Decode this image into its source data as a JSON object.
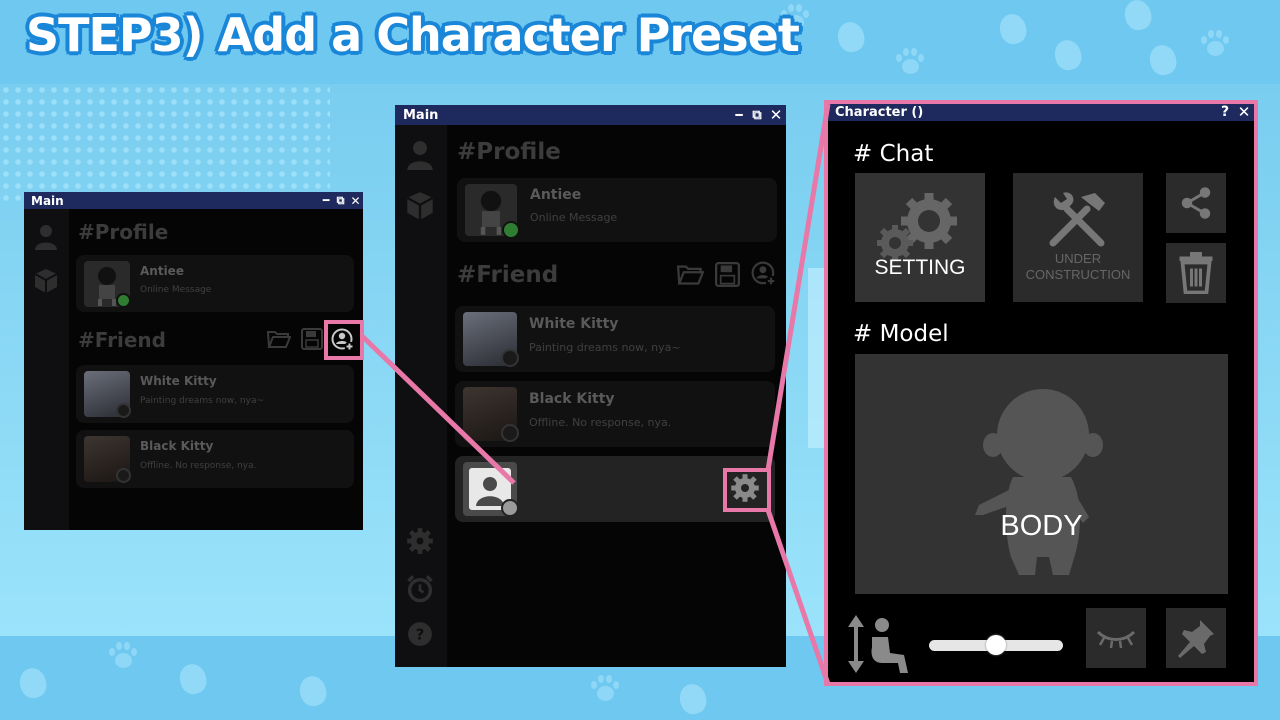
{
  "headline": "STEP3) Add a Character Preset",
  "colors": {
    "accent_pink": "#e878a8",
    "titlebar": "#1e2a5e",
    "online": "#2e7d32"
  },
  "small_window": {
    "title": "Main",
    "profile_heading": "#Profile",
    "profile": {
      "name": "Antiee",
      "message": "Online Message"
    },
    "friend_heading": "#Friend",
    "friends": [
      {
        "name": "White Kitty",
        "message": "Painting dreams now, nya~"
      },
      {
        "name": "Black Kitty",
        "message": "Offline. No response, nya."
      }
    ]
  },
  "main_window": {
    "title": "Main",
    "profile_heading": "#Profile",
    "profile": {
      "name": "Antiee",
      "message": "Online Message"
    },
    "friend_heading": "#Friend",
    "friends": [
      {
        "name": "White Kitty",
        "message": "Painting dreams now, nya~"
      },
      {
        "name": "Black Kitty",
        "message": "Offline. No response, nya."
      }
    ]
  },
  "character_window": {
    "title": "Character ()",
    "help": "?",
    "close": "✕",
    "chat_heading": "# Chat",
    "setting_label": "SETTING",
    "under_construction_label": "UNDER\nCONSTRUCTION",
    "model_heading": "# Model",
    "body_label": "BODY",
    "slider_value": 0.5
  },
  "icons": [
    "minimize-icon",
    "popout-icon",
    "close-icon",
    "person-icon",
    "cube-icon",
    "folder-icon",
    "save-icon",
    "add-user-icon",
    "gear-icon",
    "alarm-icon",
    "help-icon",
    "share-icon",
    "trash-icon",
    "tools-icon",
    "eye-closed-icon",
    "pin-icon",
    "height-icon"
  ]
}
